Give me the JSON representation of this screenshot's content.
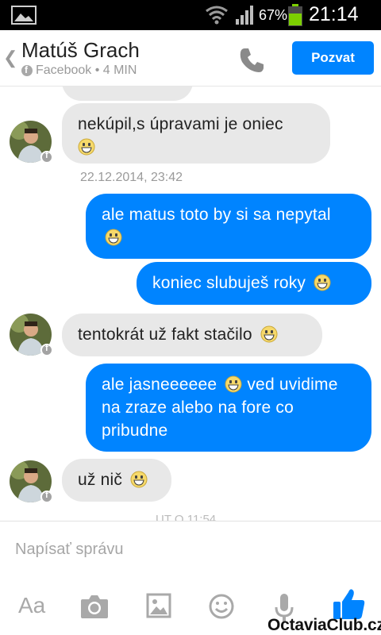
{
  "status_bar": {
    "battery_percent": "67%",
    "time": "21:14"
  },
  "header": {
    "contact_name": "Matúš Grach",
    "contact_subtitle": "Facebook • 4 MIN",
    "invite_label": "Pozvat"
  },
  "messages": [
    {
      "side": "in",
      "text": "nekúpil,s úpravami je oniec",
      "emoji": true
    },
    {
      "type": "timestamp",
      "text": "22.12.2014, 23:42"
    },
    {
      "side": "out",
      "text": "ale matus toto by si sa nepytal",
      "emoji": true
    },
    {
      "side": "out",
      "text": "koniec slubuješ roky",
      "emoji": true
    },
    {
      "side": "in",
      "text": "tentokrát už fakt stačilo",
      "emoji": true
    },
    {
      "side": "out",
      "text": "ale jasneeeeee",
      "text_after": "ved uvidime na zraze alebo na fore co pribudne",
      "emoji": true
    },
    {
      "side": "in",
      "text": "už nič",
      "emoji": true
    },
    {
      "type": "timestamp",
      "text": "UT O 11:54"
    }
  ],
  "composer": {
    "placeholder": "Napísať správu",
    "aa_label": "Aa"
  },
  "icons": {
    "camera": "camera-icon",
    "photo": "photo-icon",
    "smile": "smile-icon",
    "mic": "microphone-icon",
    "like": "thumbs-up-icon"
  },
  "colors": {
    "accent": "#0084ff",
    "incoming_bubble": "#e8e8e8",
    "status_bar": "#000000"
  },
  "watermark": "OctaviaClub.cz"
}
